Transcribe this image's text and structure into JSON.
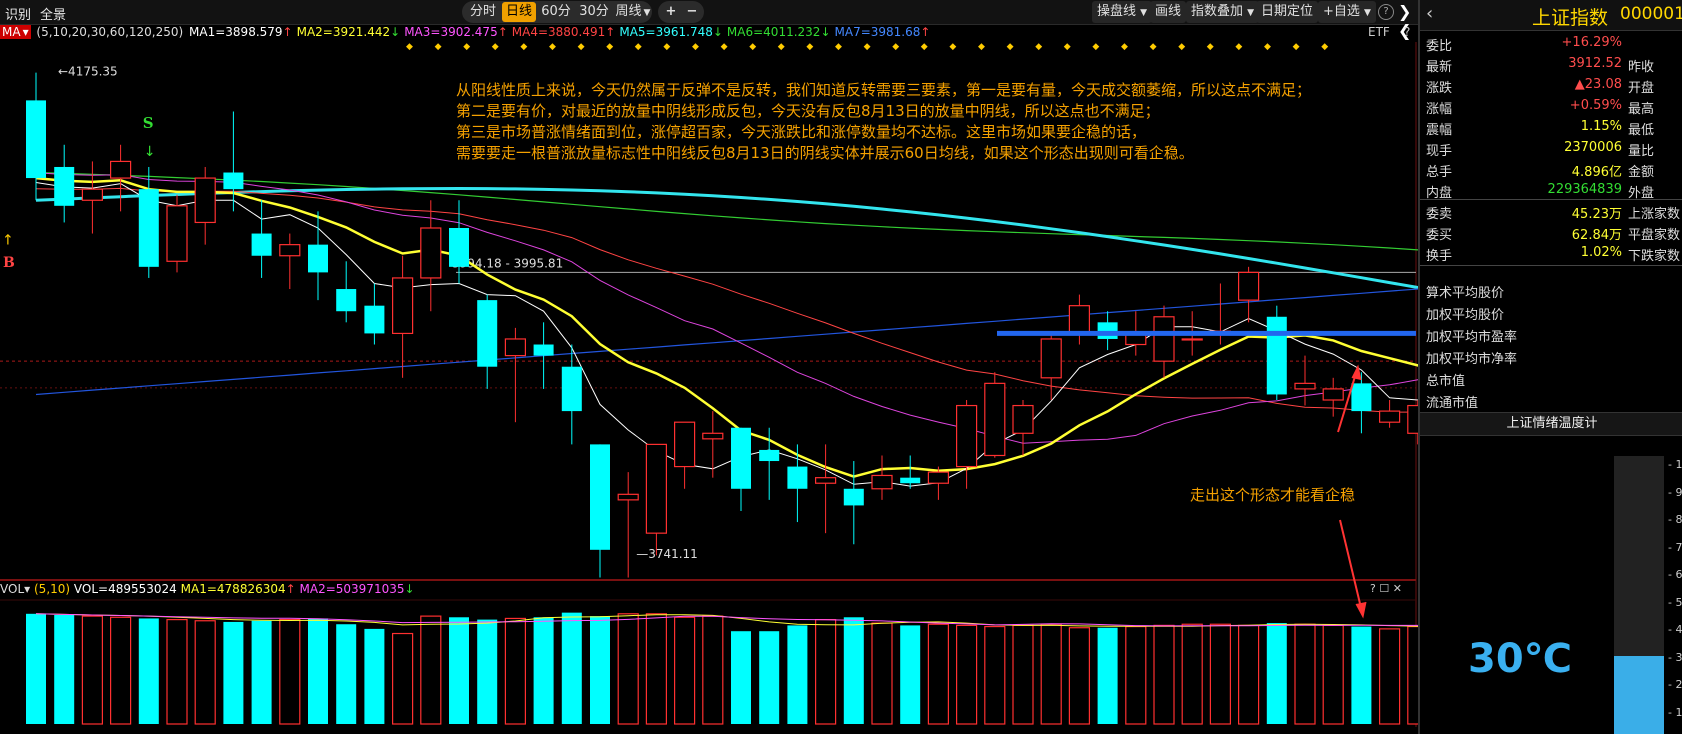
{
  "toolbar": {
    "left_items": [
      "识别",
      "全景"
    ],
    "period_tabs": [
      "分时",
      "日线",
      "60分",
      "30分",
      "周线"
    ],
    "active_period": "日线",
    "zoom_in": "+",
    "zoom_out": "−",
    "right_items": [
      "操盘线",
      "画线",
      "指数叠加",
      "日期定位",
      "+自选",
      "?"
    ]
  },
  "ma_info": {
    "indicator": "MA",
    "params": "(5,10,20,30,60,120,250)",
    "items": [
      {
        "text": "MA1=3898.579",
        "arrow": "↑",
        "color": "#ffffff"
      },
      {
        "text": "MA2=3921.442",
        "arrow": "↓",
        "color": "#ffff33"
      },
      {
        "text": "MA3=3902.475",
        "arrow": "↑",
        "color": "#ff55ff"
      },
      {
        "text": "MA4=3880.491",
        "arrow": "↑",
        "color": "#ff4444"
      },
      {
        "text": "MA5=3961.748",
        "arrow": "↓",
        "color": "#33ffff"
      },
      {
        "text": "MA6=4011.232",
        "arrow": "↓",
        "color": "#33dd33"
      },
      {
        "text": "MA7=3981.68",
        "arrow": "↑",
        "color": "#4488ff"
      }
    ],
    "etf_label": "ETF",
    "help": "?"
  },
  "chart_data": {
    "type": "candlestick",
    "high_label": "4175.35",
    "low_label": "3741.11",
    "line_label": "3994.18 - 3995.81",
    "signal_s": "S",
    "signal_b": "B",
    "ohlc": [
      [
        4150,
        4175,
        4060,
        4080
      ],
      [
        4090,
        4110,
        4040,
        4055
      ],
      [
        4060,
        4095,
        4030,
        4070
      ],
      [
        4080,
        4110,
        4050,
        4095
      ],
      [
        4070,
        4090,
        3990,
        4000
      ],
      [
        4005,
        4065,
        3995,
        4055
      ],
      [
        4040,
        4090,
        4020,
        4080
      ],
      [
        4085,
        4140,
        4050,
        4070
      ],
      [
        4030,
        4060,
        3990,
        4010
      ],
      [
        4010,
        4030,
        3980,
        4020
      ],
      [
        4020,
        4050,
        3970,
        3995
      ],
      [
        3980,
        4005,
        3950,
        3960
      ],
      [
        3965,
        3985,
        3930,
        3940
      ],
      [
        3940,
        4010,
        3900,
        3990
      ],
      [
        3990,
        4060,
        3960,
        4035
      ],
      [
        4035,
        4060,
        3985,
        4000
      ],
      [
        3970,
        3975,
        3890,
        3910
      ],
      [
        3920,
        3945,
        3860,
        3935
      ],
      [
        3930,
        3950,
        3890,
        3920
      ],
      [
        3910,
        3930,
        3840,
        3870
      ],
      [
        3840,
        3840,
        3720,
        3745
      ],
      [
        3790,
        3815,
        3720,
        3795
      ],
      [
        3760,
        3840,
        3740,
        3840
      ],
      [
        3820,
        3860,
        3800,
        3860
      ],
      [
        3845,
        3870,
        3810,
        3850
      ],
      [
        3855,
        3855,
        3780,
        3800
      ],
      [
        3835,
        3855,
        3790,
        3825
      ],
      [
        3820,
        3840,
        3770,
        3800
      ],
      [
        3805,
        3840,
        3760,
        3810
      ],
      [
        3800,
        3825,
        3750,
        3785
      ],
      [
        3800,
        3830,
        3790,
        3812
      ],
      [
        3810,
        3830,
        3800,
        3805
      ],
      [
        3805,
        3820,
        3790,
        3815
      ],
      [
        3820,
        3880,
        3800,
        3875
      ],
      [
        3830,
        3905,
        3828,
        3895
      ],
      [
        3850,
        3880,
        3830,
        3875
      ],
      [
        3900,
        3940,
        3880,
        3935
      ],
      [
        3940,
        3975,
        3930,
        3965
      ],
      [
        3950,
        3960,
        3925,
        3935
      ],
      [
        3930,
        3960,
        3920,
        3940
      ],
      [
        3915,
        3965,
        3900,
        3955
      ],
      [
        3935,
        3960,
        3920,
        3935
      ],
      [
        3940,
        3985,
        3930,
        3942
      ],
      [
        3970,
        4000,
        3950,
        3995
      ],
      [
        3955,
        3965,
        3880,
        3885
      ],
      [
        3890,
        3920,
        3875,
        3895
      ],
      [
        3880,
        3900,
        3865,
        3890
      ],
      [
        3895,
        3905,
        3850,
        3870
      ],
      [
        3860,
        3880,
        3855,
        3870
      ],
      [
        3850,
        3880,
        3840,
        3875
      ],
      [
        3880,
        3915,
        3875,
        3912
      ]
    ],
    "volume": [
      95,
      94,
      93,
      92,
      91,
      90,
      89,
      88,
      89,
      90,
      91,
      86,
      82,
      78,
      93,
      92,
      90,
      91,
      92,
      96,
      93,
      95,
      95,
      92,
      93,
      80,
      80,
      85,
      90,
      92,
      87,
      85,
      86,
      85,
      84,
      85,
      86,
      83,
      83,
      84,
      85,
      86,
      86,
      85,
      87,
      86,
      85,
      84,
      82,
      84,
      83
    ]
  },
  "annotation": {
    "lines": [
      "从阳线性质上来说，今天仍然属于反弹不是反转，我们知道反转需要三要素，第一是要有量，今天成交额萎缩，所以这点不满足；",
      "第二是要有价，对最近的放量中阴线形成反包，今天没有反包8月13日的放量中阴线，所以这点也不满足；",
      "第三是市场普涨情绪面到位，涨停超百家，今天涨跌比和涨停数量均不达标。这里市场如果要企稳的话，",
      "需要要走一根普涨放量标志性中阳线反包8月13日的阴线实体并展示60日均线，如果这个形态出现则可看企稳。"
    ],
    "note": "走出这个形态才能看企稳"
  },
  "vol_info": {
    "indicator": "VOL",
    "params": "(5,10)",
    "vol": "VOL=489553024",
    "ma1": "MA1=478826304",
    "ma1_arrow": "↑",
    "ma2": "MA2=503971035",
    "ma2_arrow": "↓"
  },
  "quote": {
    "title": "上证指数",
    "code": "000001",
    "rows": [
      {
        "label": "委比",
        "value": "+16.29%",
        "color": "#ff4d4d",
        "label2": ""
      },
      {
        "label": "最新",
        "value": "3912.52",
        "color": "#ff4d4d",
        "label2": "昨收"
      },
      {
        "label": "涨跌",
        "value": "▲23.08",
        "color": "#ff4d4d",
        "label2": "开盘"
      },
      {
        "label": "涨幅",
        "value": "+0.59%",
        "color": "#ff4d4d",
        "label2": "最高"
      },
      {
        "label": "震幅",
        "value": "1.15%",
        "color": "#ffff33",
        "label2": "最低"
      },
      {
        "label": "现手",
        "value": "2370006",
        "color": "#ffff33",
        "label2": "量比"
      },
      {
        "label": "总手",
        "value": "4.896亿",
        "color": "#ffff33",
        "label2": "金额"
      },
      {
        "label": "内盘",
        "value": "229364839",
        "color": "#33dd33",
        "label2": "外盘"
      },
      {
        "label": "委卖",
        "value": "45.23万",
        "color": "#ffff33",
        "label2": "上涨家数"
      },
      {
        "label": "委买",
        "value": "62.84万",
        "color": "#ffff33",
        "label2": "平盘家数"
      },
      {
        "label": "换手",
        "value": "1.02%",
        "color": "#ffff33",
        "label2": "下跌家数"
      }
    ],
    "stats": [
      "算术平均股价",
      "加权平均股价",
      "加权平均市盈率",
      "加权平均市净率",
      "总市值",
      "流通市值"
    ],
    "temp_title": "上证情绪温度计",
    "temp_value": "30℃",
    "temp_level_pct": 30,
    "temp_ticks": [
      "1",
      "9",
      "8",
      "7",
      "6",
      "5",
      "4",
      "3",
      "2",
      "1"
    ]
  }
}
